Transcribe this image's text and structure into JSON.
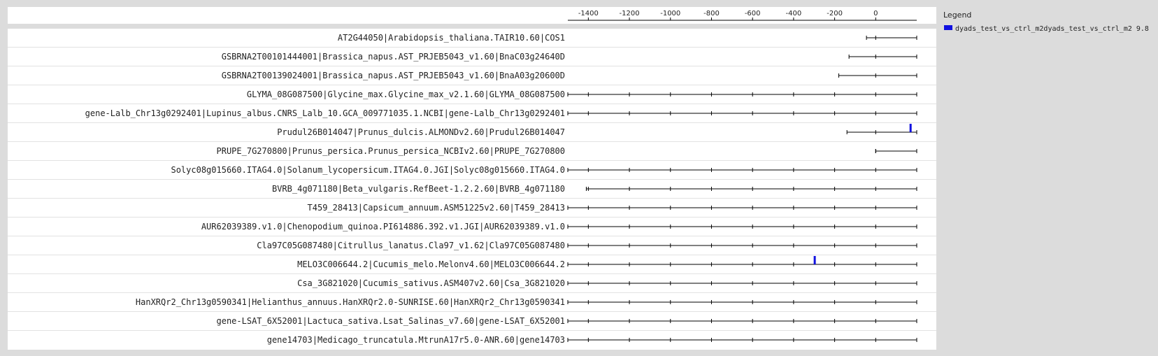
{
  "chart_data": {
    "type": "track",
    "x_ticks": [
      -1400,
      -1200,
      -1000,
      -800,
      -600,
      -400,
      -200,
      0
    ],
    "xlim": [
      -1500,
      200
    ],
    "legend": {
      "title": "Legend",
      "entries": [
        {
          "label": "dyads_test_vs_ctrl_m2dyads_test_vs_ctrl_m2 9.8",
          "color": "#1010e0"
        }
      ]
    },
    "rows": [
      {
        "label": "AT2G44050|Arabidopsis_thaliana.TAIR10.60|COS1",
        "start": -45,
        "end": 200,
        "markers": []
      },
      {
        "label": "GSBRNA2T00101444001|Brassica_napus.AST_PRJEB5043_v1.60|BnaC03g24640D",
        "start": -130,
        "end": 200,
        "markers": []
      },
      {
        "label": "GSBRNA2T00139024001|Brassica_napus.AST_PRJEB5043_v1.60|BnaA03g20600D",
        "start": -180,
        "end": 200,
        "markers": []
      },
      {
        "label": "GLYMA_08G087500|Glycine_max.Glycine_max_v2.1.60|GLYMA_08G087500",
        "start": -1500,
        "end": 200,
        "markers": []
      },
      {
        "label": "gene-Lalb_Chr13g0292401|Lupinus_albus.CNRS_Lalb_10.GCA_009771035.1.NCBI|gene-Lalb_Chr13g0292401",
        "start": -1500,
        "end": 200,
        "markers": []
      },
      {
        "label": "Prudul26B014047|Prunus_dulcis.ALMONDv2.60|Prudul26B014047",
        "start": -140,
        "end": 200,
        "markers": [
          170
        ]
      },
      {
        "label": "PRUPE_7G270800|Prunus_persica.Prunus_persica_NCBIv2.60|PRUPE_7G270800",
        "start": 0,
        "end": 200,
        "markers": []
      },
      {
        "label": "Solyc08g015660.ITAG4.0|Solanum_lycopersicum.ITAG4.0.JGI|Solyc08g015660.ITAG4.0",
        "start": -1500,
        "end": 200,
        "markers": []
      },
      {
        "label": "BVRB_4g071180|Beta_vulgaris.RefBeet-1.2.2.60|BVRB_4g071180",
        "start": -1410,
        "end": 200,
        "markers": []
      },
      {
        "label": "T459_28413|Capsicum_annuum.ASM51225v2.60|T459_28413",
        "start": -1500,
        "end": 200,
        "markers": []
      },
      {
        "label": "AUR62039389.v1.0|Chenopodium_quinoa.PI614886.392.v1.JGI|AUR62039389.v1.0",
        "start": -1500,
        "end": 200,
        "markers": []
      },
      {
        "label": "Cla97C05G087480|Citrullus_lanatus.Cla97_v1.62|Cla97C05G087480",
        "start": -1500,
        "end": 200,
        "markers": []
      },
      {
        "label": "MELO3C006644.2|Cucumis_melo.Melonv4.60|MELO3C006644.2",
        "start": -1500,
        "end": 200,
        "markers": [
          -297
        ]
      },
      {
        "label": "Csa_3G821020|Cucumis_sativus.ASM407v2.60|Csa_3G821020",
        "start": -1500,
        "end": 200,
        "markers": []
      },
      {
        "label": "HanXRQr2_Chr13g0590341|Helianthus_annuus.HanXRQr2.0-SUNRISE.60|HanXRQr2_Chr13g0590341",
        "start": -1500,
        "end": 200,
        "markers": []
      },
      {
        "label": "gene-LSAT_6X52001|Lactuca_sativa.Lsat_Salinas_v7.60|gene-LSAT_6X52001",
        "start": -1500,
        "end": 200,
        "markers": []
      },
      {
        "label": "gene14703|Medicago_truncatula.MtrunA17r5.0-ANR.60|gene14703",
        "start": -1500,
        "end": 200,
        "markers": []
      }
    ]
  }
}
